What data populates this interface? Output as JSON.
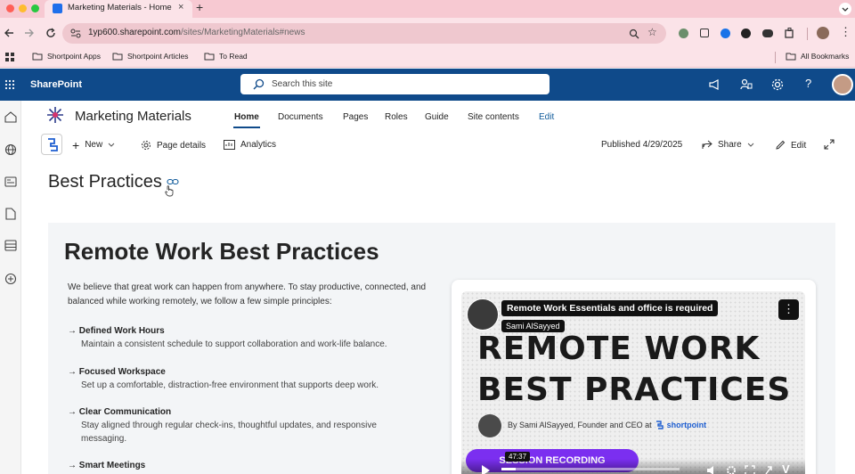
{
  "browser": {
    "tab_title": "Marketing Materials - Home",
    "url_host": "1yp600.sharepoint.com",
    "url_path": "/sites/MarketingMaterials#news",
    "bookmarks": [
      "Shortpoint Apps",
      "Shortpoint Articles",
      "To Read"
    ],
    "all_bookmarks": "All Bookmarks"
  },
  "suite": {
    "app_name": "SharePoint",
    "search_placeholder": "Search this site"
  },
  "site": {
    "title": "Marketing Materials",
    "nav": [
      "Home",
      "Documents",
      "Pages",
      "Roles",
      "Guide",
      "Site contents",
      "Edit"
    ]
  },
  "command": {
    "new": "New",
    "page_details": "Page details",
    "analytics": "Analytics",
    "published": "Published 4/29/2025",
    "share": "Share",
    "edit": "Edit"
  },
  "page": {
    "title": "Best Practices"
  },
  "content": {
    "heading": "Remote Work Best Practices",
    "intro": "We believe that great work can happen from anywhere. To stay productive, connected, and balanced while working remotely, we follow a few simple principles:",
    "items": [
      {
        "title": "Defined Work Hours",
        "desc": "Maintain a consistent schedule to support collaboration and work-life balance."
      },
      {
        "title": "Focused Workspace",
        "desc": "Set up a comfortable, distraction-free environment that supports deep work."
      },
      {
        "title": "Clear Communication",
        "desc": "Stay aligned through regular check-ins, thoughtful updates, and responsive messaging."
      },
      {
        "title": "Smart Meetings",
        "desc": ""
      }
    ]
  },
  "video": {
    "title": "Remote Work Essentials and office is required",
    "channel": "Sami AlSayyed",
    "headline_1": "REMOTE WORK",
    "headline_2": "BEST PRACTICES",
    "byline": "By Sami AlSayyed, Founder and CEO at",
    "brand": "shortpoint",
    "button": "SESSION RECORDING",
    "duration": "47:37",
    "accent": "#8a2be2"
  }
}
